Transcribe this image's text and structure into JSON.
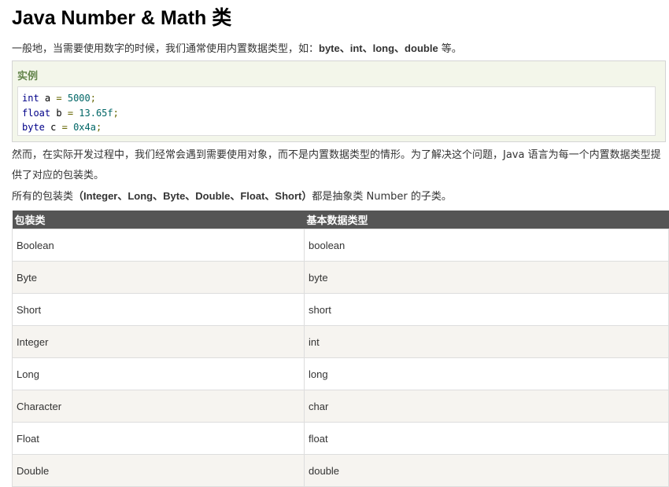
{
  "title": "Java Number & Math 类",
  "intro": {
    "text": "一般地，当需要使用数字的时候，我们通常使用内置数据类型，如：",
    "types": "byte、int、long、double",
    "suffix": " 等。"
  },
  "example": {
    "heading": "实例",
    "lines": [
      {
        "type": "int",
        "var": "a",
        "op": " = ",
        "value": "5000",
        "end": ";"
      },
      {
        "type": "float",
        "var": "b",
        "op": " = ",
        "value": "13.65f",
        "end": ";"
      },
      {
        "type": "byte",
        "var": "c",
        "op": " = ",
        "value": "0x4a",
        "end": ";"
      }
    ]
  },
  "paragraph1": "然而，在实际开发过程中，我们经常会遇到需要使用对象，而不是内置数据类型的情形。为了解决这个问题，Java 语言为每一个内置数据类型提供了对应的包装类。",
  "paragraph2": {
    "prefix": "所有的包装类",
    "classes": "（Integer、Long、Byte、Double、Float、Short）",
    "suffix": "都是抽象类 Number 的子类。"
  },
  "table": {
    "headers": [
      "包装类",
      "基本数据类型"
    ],
    "rows": [
      [
        "Boolean",
        "boolean"
      ],
      [
        "Byte",
        "byte"
      ],
      [
        "Short",
        "short"
      ],
      [
        "Integer",
        "int"
      ],
      [
        "Long",
        "long"
      ],
      [
        "Character",
        "char"
      ],
      [
        "Float",
        "float"
      ],
      [
        "Double",
        "double"
      ]
    ]
  }
}
